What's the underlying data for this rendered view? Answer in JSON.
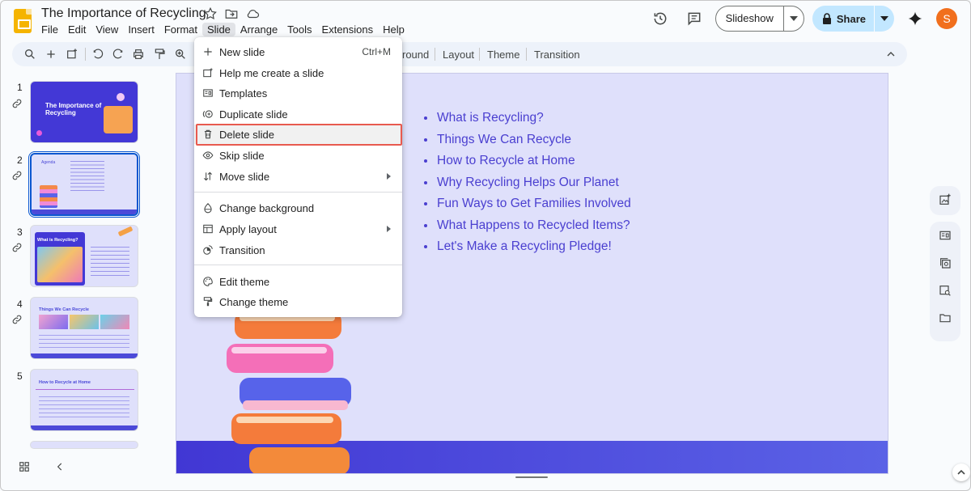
{
  "app": {
    "doc_title": "The Importance of Recycling",
    "menus": [
      "File",
      "Edit",
      "View",
      "Insert",
      "Format",
      "Slide",
      "Arrange",
      "Tools",
      "Extensions",
      "Help"
    ],
    "active_menu": "Slide",
    "slideshow_label": "Slideshow",
    "share_label": "Share",
    "avatar_letter": "S",
    "accent": "#0b57d0",
    "share_bg": "#c2e7ff",
    "avatar_color": "#f16f1d"
  },
  "toolbar": {
    "background_label": "round",
    "layout_label": "Layout",
    "theme_label": "Theme",
    "transition_label": "Transition"
  },
  "slide_menu": {
    "items": [
      {
        "label": "New slide",
        "icon": "plus-icon",
        "shortcut": "Ctrl+M"
      },
      {
        "label": "Help me create a slide",
        "icon": "sparkle-slide-icon"
      },
      {
        "label": "Templates",
        "icon": "templates-icon"
      },
      {
        "label": "Duplicate slide",
        "icon": "duplicate-icon"
      },
      {
        "label": "Delete slide",
        "icon": "trash-icon",
        "highlighted": true
      },
      {
        "label": "Skip slide",
        "icon": "eye-icon"
      },
      {
        "label": "Move slide",
        "icon": "move-icon",
        "submenu": true
      },
      {
        "label": "Change background",
        "icon": "paint-drop-icon"
      },
      {
        "label": "Apply layout",
        "icon": "layout-icon",
        "submenu": true
      },
      {
        "label": "Transition",
        "icon": "transition-icon"
      },
      {
        "label": "Edit theme",
        "icon": "palette-icon"
      },
      {
        "label": "Change theme",
        "icon": "paint-roller-icon"
      }
    ],
    "highlight_color": "#e85a4f"
  },
  "filmstrip": {
    "slides": [
      {
        "number": "1",
        "title": "The Importance of Recycling"
      },
      {
        "number": "2",
        "title": "Agenda"
      },
      {
        "number": "3",
        "title": "What is Recycling?"
      },
      {
        "number": "4",
        "title": "Things We Can Recycle"
      },
      {
        "number": "5",
        "title": "How to Recycle at Home"
      }
    ],
    "selected": 2
  },
  "slide": {
    "agenda_items": [
      "What is Recycling?",
      "Things We Can Recycle",
      "How to Recycle at Home",
      "Why Recycling Helps Our Planet",
      "Fun Ways to Get Families Involved",
      "What Happens to Recycled Items?",
      "Let's Make a Recycling Pledge!"
    ],
    "text_color": "#4a3fd0",
    "bg_color": "#dfe0fb",
    "base_color": "#4137d4"
  }
}
